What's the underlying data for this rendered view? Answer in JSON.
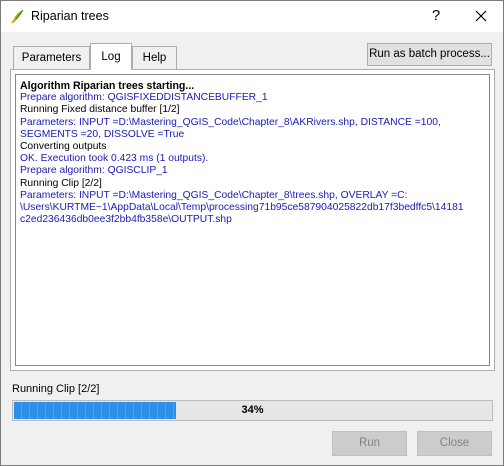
{
  "window": {
    "title": "Riparian trees",
    "help_label": "?",
    "close_label": "✕"
  },
  "tabs": [
    {
      "label": "Parameters",
      "active": false
    },
    {
      "label": "Log",
      "active": true
    },
    {
      "label": "Help",
      "active": false
    }
  ],
  "batch_button_label": "Run as batch process...",
  "log": [
    {
      "text": "Algorithm Riparian trees starting...",
      "style": "bold"
    },
    {
      "text": "Prepare algorithm: QGISFIXEDDISTANCEBUFFER_1",
      "style": "blue"
    },
    {
      "text": "Running Fixed distance buffer [1/2]",
      "style": "black"
    },
    {
      "text": "Parameters: INPUT =D:\\Mastering_QGIS_Code\\Chapter_8\\AKRivers.shp, DISTANCE =100,",
      "style": "blue"
    },
    {
      "text": "SEGMENTS =20, DISSOLVE =True",
      "style": "blue"
    },
    {
      "text": "Converting outputs",
      "style": "black"
    },
    {
      "text": "OK. Execution took 0.423 ms (1 outputs).",
      "style": "blue"
    },
    {
      "text": "Prepare algorithm: QGISCLIP_1",
      "style": "blue"
    },
    {
      "text": "Running Clip [2/2]",
      "style": "black"
    },
    {
      "text": "Parameters: INPUT =D:\\Mastering_QGIS_Code\\Chapter_8\\trees.shp, OVERLAY =C:",
      "style": "blue"
    },
    {
      "text": "\\Users\\KURTME~1\\AppData\\Local\\Temp\\processing71b95ce587904025822db17f3bedffc5\\14181",
      "style": "blue"
    },
    {
      "text": "c2ed236436db0ee3f2bb4fb358e\\OUTPUT.shp",
      "style": "blue"
    }
  ],
  "progress": {
    "label": "Running Clip [2/2]",
    "value": 0.34,
    "text": "34%",
    "color": "#2f8fe6"
  },
  "buttons": {
    "run_label": "Run",
    "close_label": "Close"
  }
}
